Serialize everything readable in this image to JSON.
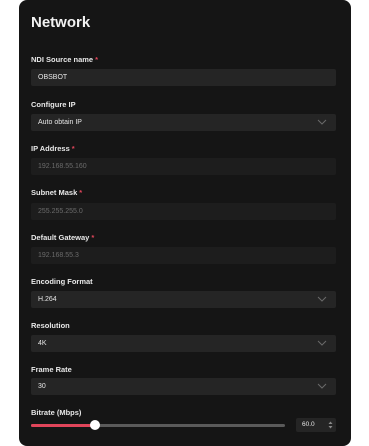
{
  "page_title": "Network",
  "fields": {
    "ndi_source_name": {
      "label": "NDI Source name",
      "required": "*",
      "value": "OBSBOT"
    },
    "configure_ip": {
      "label": "Configure IP",
      "value": "Auto obtain IP"
    },
    "ip_address": {
      "label": "IP Address",
      "required": "*",
      "value": "192.168.55.160"
    },
    "subnet_mask": {
      "label": "Subnet Mask",
      "required": "*",
      "value": "255.255.255.0"
    },
    "default_gateway": {
      "label": "Default Gateway",
      "required": "*",
      "value": "192.168.55.3"
    },
    "encoding_format": {
      "label": "Encoding Format",
      "value": "H.264"
    },
    "resolution": {
      "label": "Resolution",
      "value": "4K"
    },
    "frame_rate": {
      "label": "Frame Rate",
      "value": "30"
    },
    "bitrate": {
      "label": "Bitrate (Mbps)",
      "value": "60.0",
      "fraction": 0.25
    }
  },
  "colors": {
    "accent": "#e0455a",
    "panel": "#151515",
    "input": "#252525"
  }
}
